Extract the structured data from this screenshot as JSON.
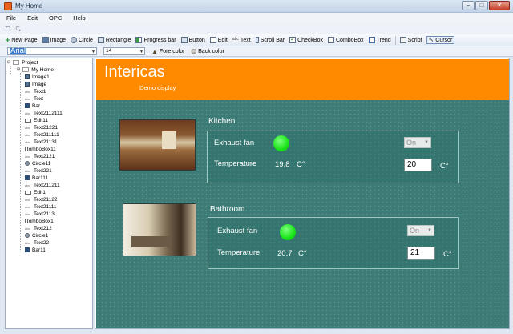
{
  "window": {
    "title": "My Home"
  },
  "menu": [
    "File",
    "Edit",
    "OPC",
    "Help"
  ],
  "toolbar": [
    {
      "label": "New Page",
      "icon": "plus-icon"
    },
    {
      "label": "Image",
      "icon": "image-icon"
    },
    {
      "label": "Circle",
      "icon": "circle-icon"
    },
    {
      "label": "Rectangle",
      "icon": "rectangle-icon"
    },
    {
      "label": "Progress bar",
      "icon": "progress-bar-icon"
    },
    {
      "label": "Button",
      "icon": "button-icon"
    },
    {
      "label": "Edit",
      "icon": "edit-icon"
    },
    {
      "label": "Text",
      "icon": "text-icon"
    },
    {
      "label": "Scroll Bar",
      "icon": "scroll-bar-icon"
    },
    {
      "label": "CheckBox",
      "icon": "checkbox-icon"
    },
    {
      "label": "ComboBox",
      "icon": "combobox-icon"
    },
    {
      "label": "Trend",
      "icon": "trend-icon"
    },
    {
      "label": "Script",
      "icon": "script-icon"
    },
    {
      "label": "Cursor",
      "icon": "cursor-icon"
    }
  ],
  "format": {
    "font": "Arial",
    "size": "14",
    "fore_color": "Fore color",
    "back_color": "Back color"
  },
  "tree": {
    "root": "Project",
    "page": "My Home",
    "items": [
      {
        "label": "Image1",
        "type": "img"
      },
      {
        "label": "Image",
        "type": "img"
      },
      {
        "label": "Text1",
        "type": "abc"
      },
      {
        "label": "Text",
        "type": "abc"
      },
      {
        "label": "Bar",
        "type": "bar"
      },
      {
        "label": "Text2112111",
        "type": "abc"
      },
      {
        "label": "Edit11",
        "type": "edit"
      },
      {
        "label": "Text21221",
        "type": "abc"
      },
      {
        "label": "Text211111",
        "type": "abc"
      },
      {
        "label": "Text21131",
        "type": "abc"
      },
      {
        "label": "ComboBox11",
        "type": "combo"
      },
      {
        "label": "Text2121",
        "type": "abc"
      },
      {
        "label": "Circle11",
        "type": "circle"
      },
      {
        "label": "Text221",
        "type": "abc"
      },
      {
        "label": "Bar111",
        "type": "bar"
      },
      {
        "label": "Text211211",
        "type": "abc"
      },
      {
        "label": "Edit1",
        "type": "edit"
      },
      {
        "label": "Text21122",
        "type": "abc"
      },
      {
        "label": "Text21111",
        "type": "abc"
      },
      {
        "label": "Text2113",
        "type": "abc"
      },
      {
        "label": "ComboBox1",
        "type": "combo"
      },
      {
        "label": "Text212",
        "type": "abc"
      },
      {
        "label": "Circle1",
        "type": "circle"
      },
      {
        "label": "Text22",
        "type": "abc"
      },
      {
        "label": "Bar11",
        "type": "bar"
      }
    ]
  },
  "display": {
    "title": "Intericas",
    "subtitle": "Demo display",
    "kitchen": {
      "title": "Kitchen",
      "fan_label": "Exhaust fan",
      "fan_state": "On",
      "temp_label": "Temperature",
      "temp_value": "19,8",
      "temp_unit": "C°",
      "setpoint": "20",
      "setpoint_unit": "C°"
    },
    "bathroom": {
      "title": "Bathroom",
      "fan_label": "Exhaust fan",
      "fan_state": "On",
      "temp_label": "Temperature",
      "temp_value": "20,7",
      "temp_unit": "C°",
      "setpoint": "21",
      "setpoint_unit": "C°"
    }
  },
  "colors": {
    "header": "#ff8a00",
    "canvas": "#3c7b76",
    "led_on": "#18e418"
  }
}
